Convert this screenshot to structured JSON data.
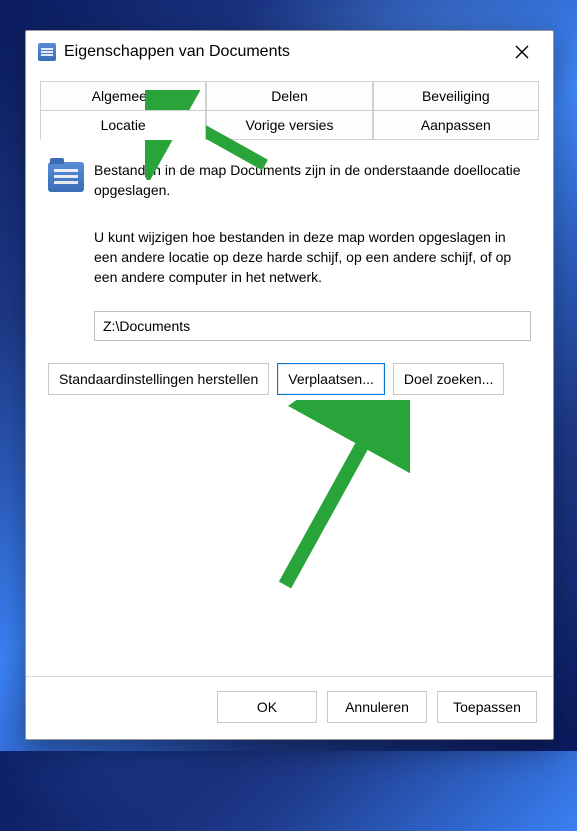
{
  "window": {
    "title": "Eigenschappen van Documents"
  },
  "tabs": {
    "row1": [
      "Algemeen",
      "Delen",
      "Beveiliging"
    ],
    "row2": [
      "Locatie",
      "Vorige versies",
      "Aanpassen"
    ],
    "active": "Locatie"
  },
  "content": {
    "folder_desc": "Bestanden in de map Documents zijn in de onderstaande doellocatie opgeslagen.",
    "info": "U kunt wijzigen hoe bestanden in deze map worden opgeslagen in een andere locatie op deze harde schijf, op een andere schijf, of op een andere computer in het netwerk.",
    "path_value": "Z:\\Documents",
    "buttons": {
      "restore": "Standaardinstellingen herstellen",
      "move": "Verplaatsen...",
      "find": "Doel zoeken..."
    }
  },
  "footer": {
    "ok": "OK",
    "cancel": "Annuleren",
    "apply": "Toepassen"
  }
}
